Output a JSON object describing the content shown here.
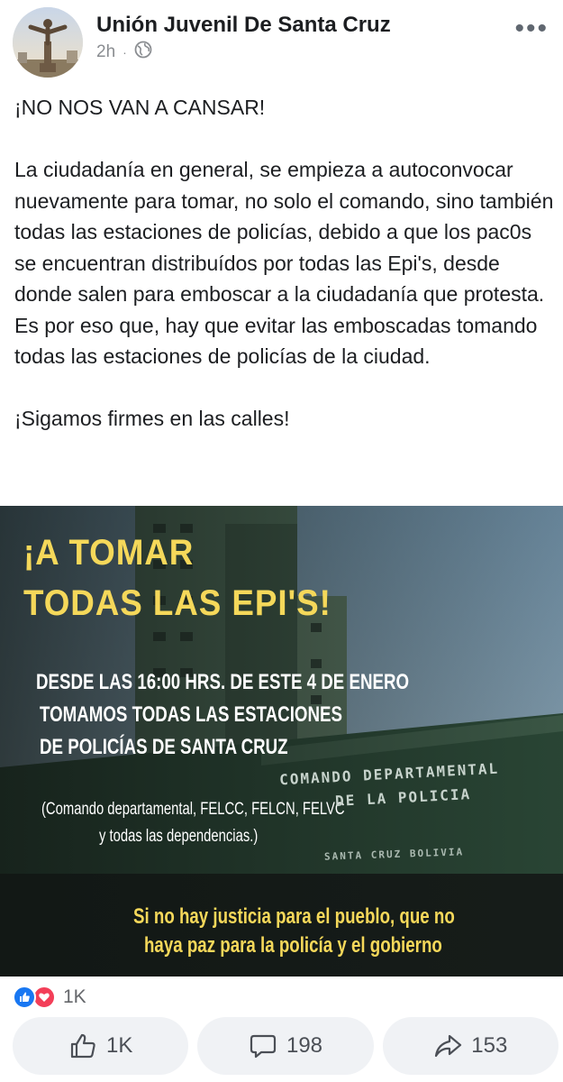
{
  "post": {
    "author": "Unión Juvenil De Santa Cruz",
    "time": "2h",
    "dot": "·",
    "privacy_icon": "globe-icon",
    "more_icon": "more-options-icon",
    "more": "•••",
    "paragraphs": [
      "¡NO NOS VAN A CANSAR!",
      "La ciudadanía en general, se empieza a autoconvocar nuevamente para tomar, no solo el comando, sino también todas las estaciones de policías, debido a que los pac0s se encuentran distribuídos por todas las Epi's, desde donde salen para emboscar a la ciudadanía que protesta. Es por eso que, hay que evitar las emboscadas tomando todas las estaciones de policías de la ciudad.",
      "¡Sigamos firmes en las calles!"
    ]
  },
  "image": {
    "title_line1": "¡A TOMAR",
    "title_line2": "TODAS LAS EPI'S!",
    "body_line1": "DESDE LAS 16:00 HRS.  DE ESTE 4 DE ENERO",
    "body_line2": "TOMAMOS TODAS LAS ESTACIONES",
    "body_line3": "DE POLICÍAS DE SANTA CRUZ",
    "note_line1": "(Comando departamental, FELCC, FELCN, FELVC",
    "note_line2": "y todas las dependencias.)",
    "sign_line1": "COMANDO DEPARTAMENTAL",
    "sign_line2": "DE LA POLICIA",
    "sign_line3": "SANTA CRUZ    BOLIVIA",
    "footer_line1": "Si no hay justicia para el pueblo, que no",
    "footer_line2": "haya paz para la policía y el gobierno"
  },
  "reactions": {
    "icons": [
      "like-reaction-icon",
      "love-reaction-icon"
    ],
    "count": "1K"
  },
  "actions": [
    {
      "icon": "thumbs-up-icon",
      "label": "1K"
    },
    {
      "icon": "comment-icon",
      "label": "198"
    },
    {
      "icon": "share-icon",
      "label": "153"
    }
  ],
  "colors": {
    "like_blue": "#1877f2",
    "love_red": "#f33e58",
    "image_yellow": "#f5d85a"
  }
}
